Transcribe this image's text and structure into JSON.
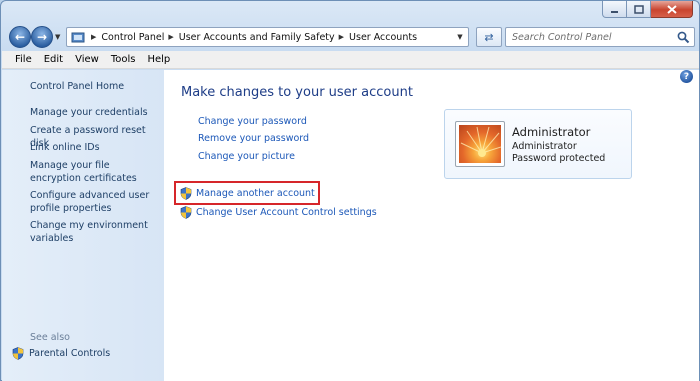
{
  "nav": {
    "breadcrumbs": [
      "Control Panel",
      "User Accounts and Family Safety",
      "User Accounts"
    ],
    "search_placeholder": "Search Control Panel"
  },
  "menu": [
    "File",
    "Edit",
    "View",
    "Tools",
    "Help"
  ],
  "sidebar": {
    "home": "Control Panel Home",
    "links": [
      "Manage your credentials",
      "Create a password reset disk",
      "Link online IDs",
      "Manage your file encryption certificates",
      "Configure advanced user profile properties",
      "Change my environment variables"
    ],
    "see_also": "See also",
    "parental_controls": "Parental Controls"
  },
  "main": {
    "heading": "Make changes to your user account",
    "tasks": [
      "Change your password",
      "Remove your password",
      "Change your picture"
    ],
    "shield_tasks": [
      "Manage another account",
      "Change User Account Control settings"
    ]
  },
  "account": {
    "name": "Administrator",
    "type": "Administrator",
    "status": "Password protected"
  },
  "colors": {
    "link": "#1c58b8",
    "heading": "#1e3d87",
    "highlight": "#d6262a"
  }
}
